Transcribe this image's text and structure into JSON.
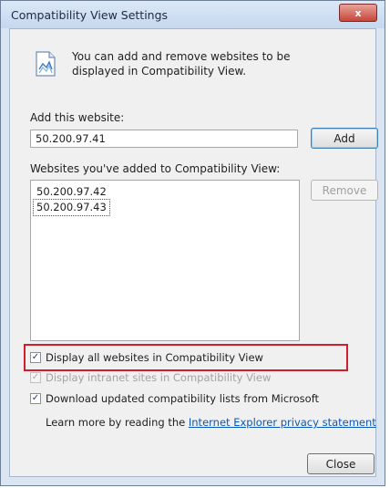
{
  "window": {
    "title": "Compatibility View Settings",
    "close_glyph": "x"
  },
  "info": {
    "icon": "compatibility-page-icon",
    "text": "You can add and remove websites to be displayed in Compatibility View."
  },
  "add_website": {
    "label": "Add this website:",
    "value": "50.200.97.41",
    "button_label": "Add"
  },
  "websites_list": {
    "label": "Websites you've added to Compatibility View:",
    "items": [
      "50.200.97.42",
      "50.200.97.43"
    ],
    "remove_label": "Remove"
  },
  "options": {
    "display_all": {
      "label": "Display all websites in Compatibility View",
      "checked": true
    },
    "display_intranet": {
      "label": "Display intranet sites in Compatibility View",
      "checked": true,
      "disabled": true
    },
    "download_updated": {
      "label": "Download updated compatibility lists from Microsoft",
      "checked": true
    }
  },
  "learn_more": {
    "prefix": "Learn more by reading the",
    "link_text": "Internet Explorer privacy statement"
  },
  "footer": {
    "close_label": "Close"
  },
  "colors": {
    "highlight_border": "#d01f2b",
    "link": "#0a58bd"
  }
}
